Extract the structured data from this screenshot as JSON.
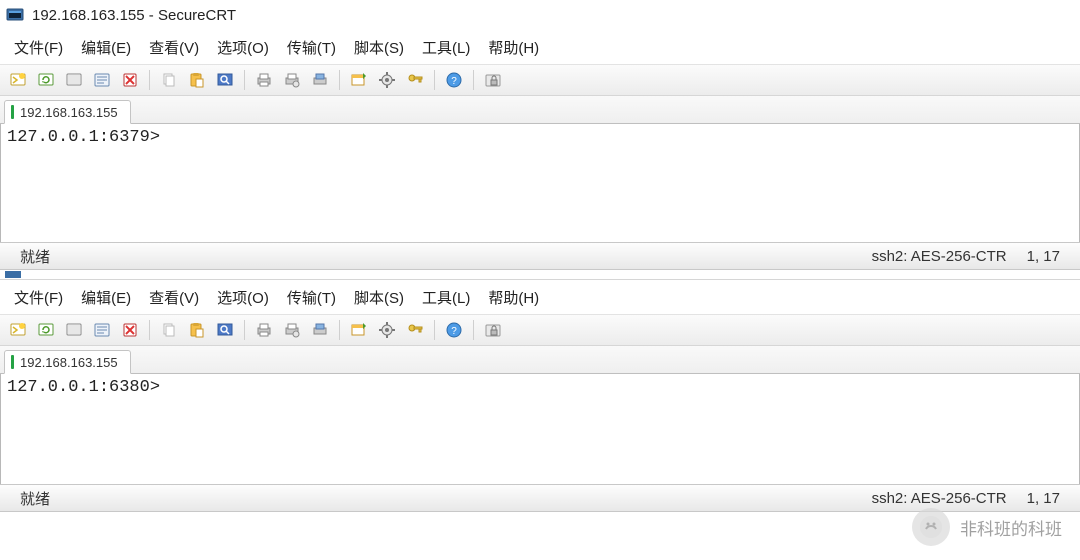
{
  "app": {
    "title_ip": "192.168.163.155",
    "title_app": "SecureCRT",
    "title_sep": " - "
  },
  "menus": {
    "file": "文件(F)",
    "edit": "编辑(E)",
    "view": "查看(V)",
    "options": "选项(O)",
    "transfer": "传输(T)",
    "script": "脚本(S)",
    "tools": "工具(L)",
    "help": "帮助(H)"
  },
  "toolbar_icons": [
    "quick-connect-icon",
    "reconnect-icon",
    "disconnect-icon",
    "session-manager-icon",
    "delete-icon",
    "SEP",
    "copy-icon",
    "paste-icon",
    "find-icon",
    "SEP",
    "print-icon",
    "print-setup-icon",
    "print-screen-icon",
    "SEP",
    "new-tab-icon",
    "options-icon",
    "key-icon",
    "SEP",
    "help-icon",
    "SEP",
    "lock-session-icon"
  ],
  "windows": [
    {
      "tab_label": "192.168.163.155",
      "terminal_line": "127.0.0.1:6379>",
      "status_left": "就绪",
      "status_proto": "ssh2: AES-256-CTR",
      "status_pos": "1,  17"
    },
    {
      "tab_label": "192.168.163.155",
      "terminal_line": "127.0.0.1:6380>",
      "status_left": "就绪",
      "status_proto": "ssh2: AES-256-CTR",
      "status_pos": "1,  17"
    }
  ],
  "watermark": {
    "text": "非科班的科班",
    "faint": ""
  }
}
